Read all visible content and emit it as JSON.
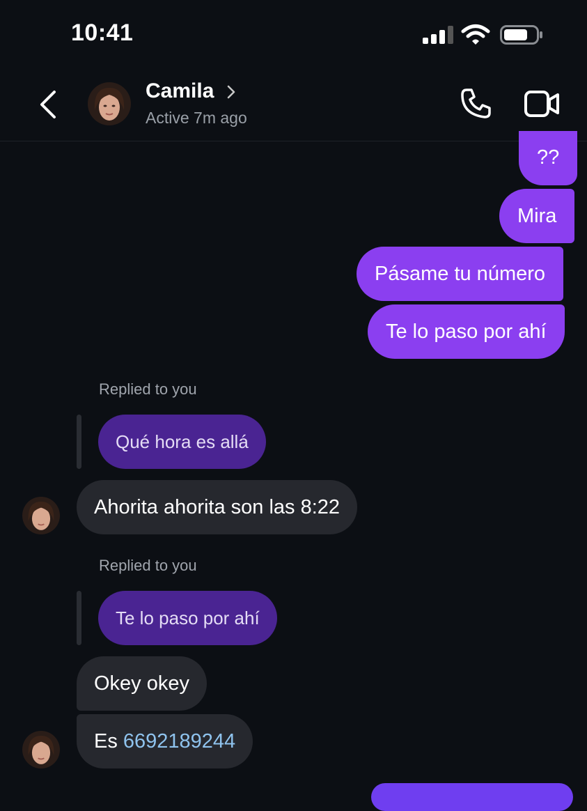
{
  "status_bar": {
    "time": "10:41"
  },
  "header": {
    "contact_name": "Camila",
    "active_status": "Active 7m ago"
  },
  "messages": {
    "out_1": "??",
    "out_2": "Mira",
    "out_3": "Pásame tu número",
    "out_4": "Te lo paso por ahí",
    "reply_label_1": "Replied to you",
    "quote_1": "Qué hora es allá",
    "in_1": "Ahorita ahorita son las 8:22",
    "reply_label_2": "Replied to you",
    "quote_2": "Te lo paso por ahí",
    "in_2": "Okey okey",
    "in_3_prefix": "Es ",
    "in_3_phone": "6692189244"
  },
  "colors": {
    "background": "#0c0f14",
    "outgoing_bubble": "#8b3ff0",
    "incoming_bubble": "#26282e",
    "quoted_bubble": "#4a2492",
    "phone_link": "#8fc3ee"
  },
  "icons": [
    "cellular-signal-icon",
    "wifi-icon",
    "battery-icon",
    "back-chevron-icon",
    "chevron-right-icon",
    "phone-call-icon",
    "video-call-icon"
  ]
}
